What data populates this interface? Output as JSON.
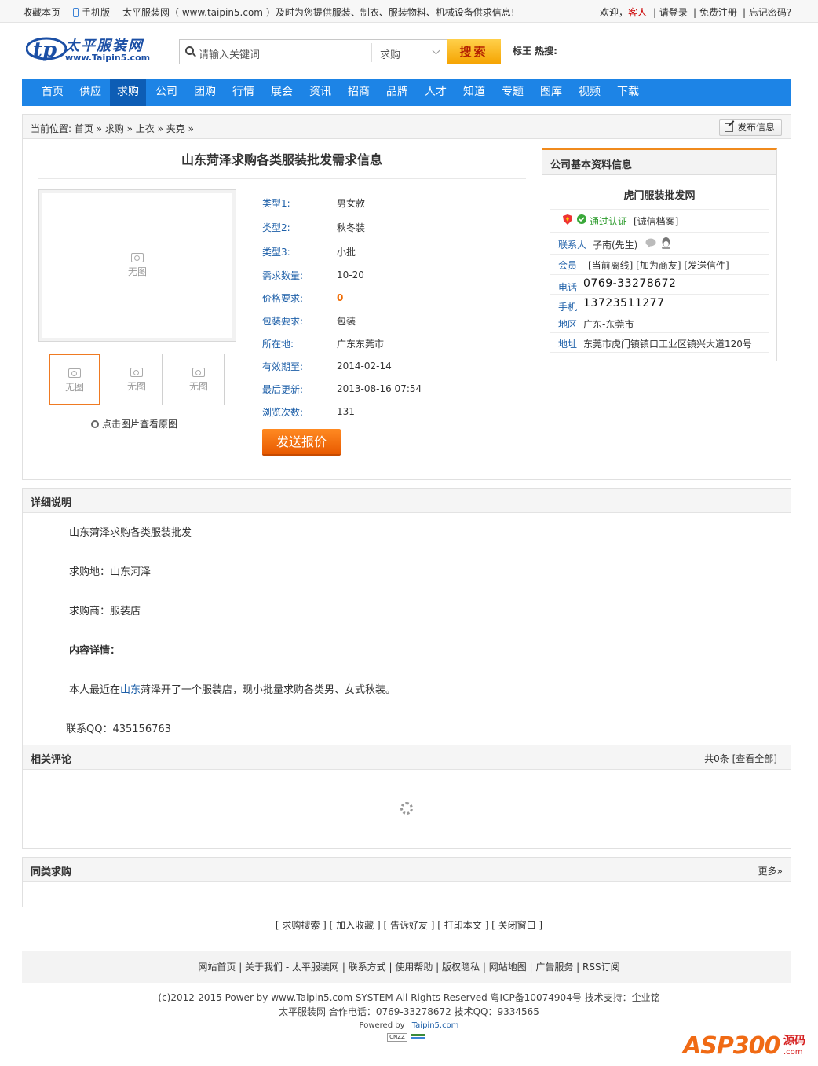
{
  "topbar": {
    "favorite": "收藏本页",
    "mobile": "手机版",
    "intro": "太平服装网（ www.taipin5.com ）及时为您提供服装、制衣、服装物料、机械设备供求信息!",
    "welcome": "欢迎，",
    "guest": "客人",
    "login": "| 请登录",
    "register": "| 免费注册",
    "forgot": "| 忘记密码?"
  },
  "logo": {
    "name": "太平服装网",
    "url": "www.Taipin5.com"
  },
  "search": {
    "placeholder": "请输入关键词",
    "type": "求购",
    "button": "搜索",
    "hot": "标王 热搜:"
  },
  "nav": [
    "首页",
    "供应",
    "求购",
    "公司",
    "团购",
    "行情",
    "展会",
    "资讯",
    "招商",
    "品牌",
    "人才",
    "知道",
    "专题",
    "图库",
    "视频",
    "下载"
  ],
  "nav_active": "求购",
  "breadcrumb": {
    "text": "当前位置: 首页 » 求购 » 上衣 » 夹克 »",
    "publish": "发布信息"
  },
  "product": {
    "title": "山东菏泽求购各类服装批发需求信息",
    "no_image": "无图",
    "zoom_hint": "点击图片查看原图",
    "specs": [
      {
        "k": "类型1:",
        "v": "男女款"
      },
      {
        "k": "类型2:",
        "v": "秋冬装"
      },
      {
        "k": "类型3:",
        "v": "小批"
      },
      {
        "k": "需求数量:",
        "v": "10-20"
      },
      {
        "k": "价格要求:",
        "v": "0"
      },
      {
        "k": "包装要求:",
        "v": "包装"
      },
      {
        "k": "所在地:",
        "v": "广东东莞市"
      },
      {
        "k": "有效期至:",
        "v": "2014-02-14"
      },
      {
        "k": "最后更新:",
        "v": "2013-08-16 07:54"
      },
      {
        "k": "浏览次数:",
        "v": "131"
      }
    ],
    "quote_button": "发送报价"
  },
  "company": {
    "header": "公司基本资料信息",
    "name": "虎门服装批发网",
    "verified": "通过认证",
    "credit": "[诚信档案]",
    "contact_label": "联系人",
    "contact": "子南(先生)",
    "member_label": "会员",
    "member_links": "[当前离线] [加为商友] [发送信件]",
    "phone_label": "电话",
    "phone": "0769-33278672",
    "mobile_label": "手机",
    "mobile": "13723511277",
    "region_label": "地区",
    "region": "广东-东莞市",
    "address_label": "地址",
    "address": "东莞市虎门镇镇口工业区镇兴大道120号"
  },
  "detail": {
    "header": "详细说明",
    "line1": "山东菏泽求购各类服装批发",
    "line2": "求购地：山东河泽",
    "line3": "求购商：服装店",
    "line4": "内容详情：",
    "line5_pre": "本人最近在",
    "line5_link": "山东",
    "line5_post": "菏泽开了一个服装店，现小批量求购各类男、女式秋装。",
    "qq": "联系QQ：435156763"
  },
  "comments": {
    "header": "相关评论",
    "count": "共0条 [查看全部]"
  },
  "similar": {
    "header": "同类求购",
    "more": "更多»"
  },
  "tools": "[ 求购搜索 ] [ 加入收藏 ] [ 告诉好友 ] [ 打印本文 ] [ 关闭窗口 ]",
  "footer": {
    "links": "网站首页 | 关于我们 - 太平服装网 | 联系方式 | 使用帮助 | 版权隐私 | 网站地图 | 广告服务 | RSS订阅",
    "copyright": "(c)2012-2015 Power by www.Taipin5.com  SYSTEM All Rights Reserved  粤ICP备10074904号   技术支持：企业铭",
    "contact": "太平服装网    合作电话：0769-33278672   技术QQ：9334565",
    "powered": "Powered by",
    "powered_link": "Taipin5.com",
    "cnzz": "CNZZ"
  },
  "watermark": {
    "brand": "ASP300",
    "cn": "源码",
    "site": ".com"
  }
}
